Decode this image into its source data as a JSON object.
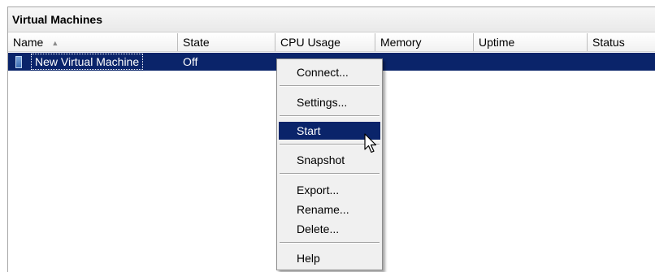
{
  "panel": {
    "title": "Virtual Machines"
  },
  "columns": [
    {
      "label": "Name",
      "sorted": "ascending"
    },
    {
      "label": "State"
    },
    {
      "label": "CPU Usage"
    },
    {
      "label": "Memory"
    },
    {
      "label": "Uptime"
    },
    {
      "label": "Status"
    }
  ],
  "rows": [
    {
      "name": "New Virtual Machine",
      "state": "Off",
      "selected": true,
      "icon": "virtual-machine-icon"
    }
  ],
  "context_menu": {
    "items": [
      {
        "label": "Connect..."
      },
      {
        "label": "Settings..."
      },
      {
        "label": "Start",
        "highlighted": true
      },
      {
        "label": "Snapshot"
      },
      {
        "label": "Export..."
      },
      {
        "label": "Rename..."
      },
      {
        "label": "Delete..."
      },
      {
        "label": "Help"
      }
    ]
  },
  "colors": {
    "selection": "#0a246a",
    "menu_background": "#f0f0f0"
  }
}
